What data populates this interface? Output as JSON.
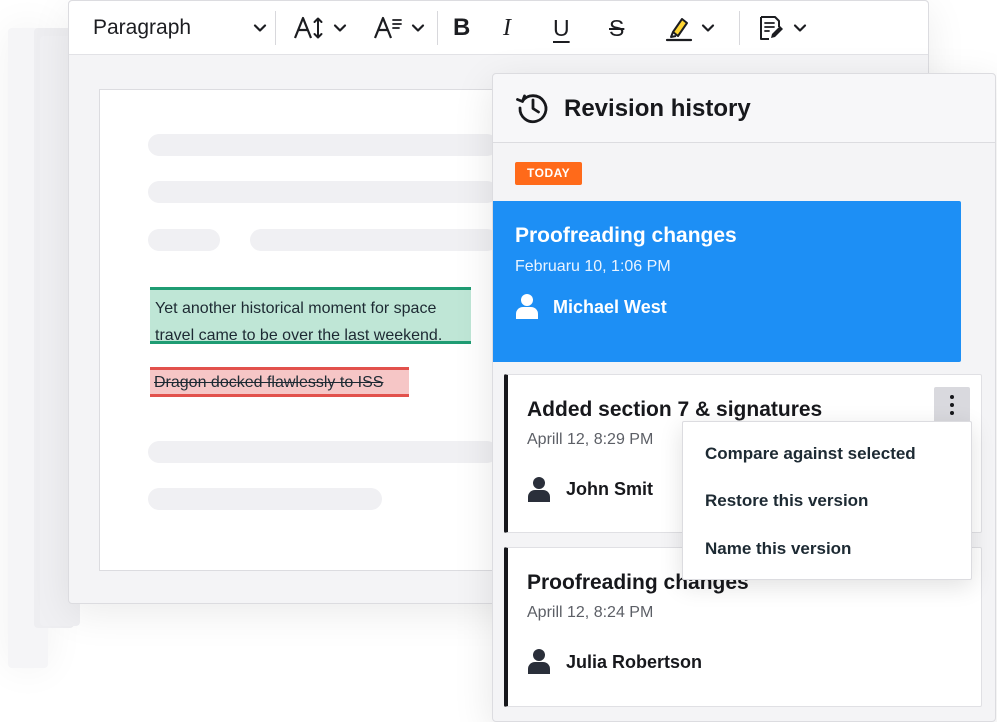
{
  "toolbar": {
    "paragraph_label": "Paragraph",
    "bold_label": "B",
    "italic_label": "I",
    "underline_label": "U",
    "strike_label": "S",
    "icons": [
      "font-size-icon",
      "font-style-icon",
      "highlight-icon",
      "track-changes-icon"
    ]
  },
  "document": {
    "inserted_text": "Yet another historical moment for space travel came to be over the last weekend.",
    "deleted_text": "Dragon docked flawlessly to ISS"
  },
  "panel": {
    "title": "Revision history",
    "badge": "TODAY",
    "revisions": [
      {
        "title": "Proofreading changes",
        "date": "Februaru 10, 1:06 PM",
        "author": "Michael West"
      },
      {
        "title": "Added section 7 & signatures",
        "date": "Aprill 12, 8:29 PM",
        "author": "John Smit"
      },
      {
        "title": "Proofreading changes",
        "date": "Aprill 12, 8:24 PM",
        "author": "Julia Robertson"
      }
    ],
    "menu": {
      "items": [
        "Compare against selected",
        "Restore this version",
        "Name this version"
      ]
    }
  },
  "colors": {
    "accent_blue": "#1d8ff5",
    "badge_orange": "#ff6a1a",
    "insert_green": "#1f9c73",
    "delete_red": "#e2514c"
  }
}
